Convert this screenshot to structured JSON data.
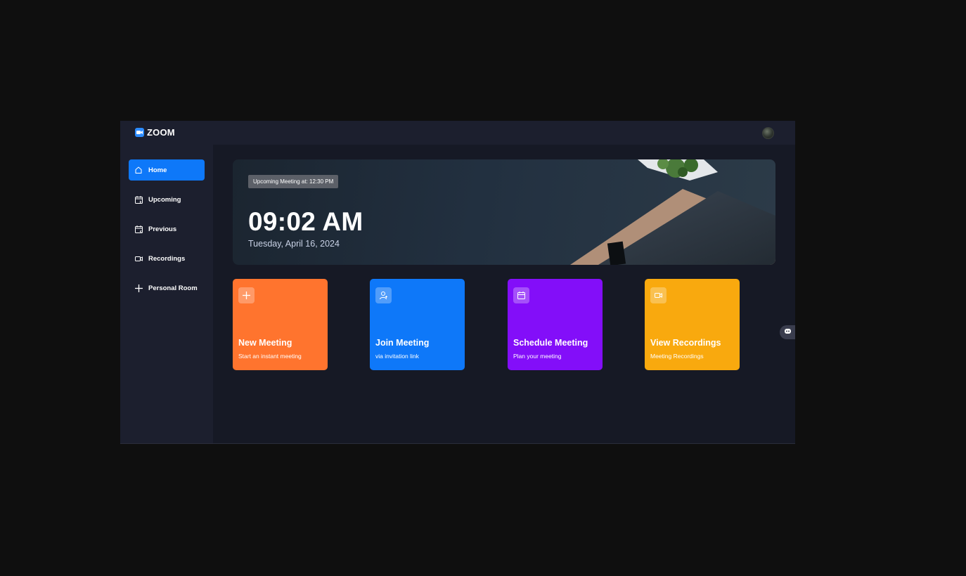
{
  "app": {
    "brand": "ZOOM"
  },
  "sidebar": {
    "items": [
      {
        "label": "Home",
        "icon": "home-icon",
        "active": true
      },
      {
        "label": "Upcoming",
        "icon": "calendar-upcoming-icon",
        "active": false
      },
      {
        "label": "Previous",
        "icon": "calendar-previous-icon",
        "active": false
      },
      {
        "label": "Recordings",
        "icon": "video-icon",
        "active": false
      },
      {
        "label": "Personal Room",
        "icon": "plus-icon",
        "active": false
      }
    ]
  },
  "hero": {
    "badge": "Upcoming Meeting at: 12:30 PM",
    "time": "09:02 AM",
    "date": "Tuesday, April 16, 2024"
  },
  "cards": [
    {
      "title": "New Meeting",
      "subtitle": "Start an instant meeting",
      "icon": "plus-icon",
      "color": "#ff742e"
    },
    {
      "title": "Join Meeting",
      "subtitle": "via invitation link",
      "icon": "user-add-icon",
      "color": "#0e78f9"
    },
    {
      "title": "Schedule Meeting",
      "subtitle": "Plan your meeting",
      "icon": "calendar-icon",
      "color": "#830ef9"
    },
    {
      "title": "View Recordings",
      "subtitle": "Meeting Recordings",
      "icon": "video-icon",
      "color": "#f9a90e"
    }
  ],
  "colors": {
    "background": "#0f0f0f",
    "app_bg": "#161925",
    "panel_bg": "#1c1f2e",
    "accent": "#0e78f9"
  }
}
